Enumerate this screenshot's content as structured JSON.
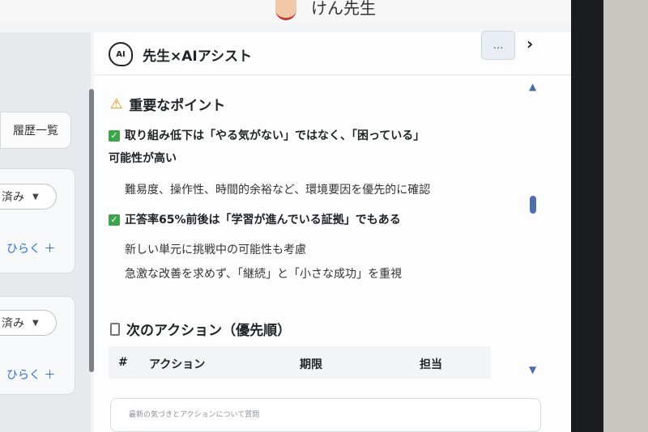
{
  "header": {
    "teacher_name": "けん先生"
  },
  "left": {
    "history_button": "履歴一覧",
    "cards": [
      {
        "status": "済み",
        "open": "ひらく ＋"
      },
      {
        "status": "済み",
        "open": "ひらく ＋"
      }
    ]
  },
  "panel": {
    "title": "先生×AIアシスト",
    "ai_icon_text": "AI",
    "more_label": "…",
    "important": {
      "heading": "重要なポイント",
      "points": [
        {
          "title_line1": "取り組み低下は「やる気がない」ではなく、「困っている」",
          "title_line2": "可能性が高い",
          "subs": [
            "難易度、操作性、時間的余裕など、環境要因を優先的に確認"
          ]
        },
        {
          "title_line1": "正答率65%前後は「学習が進んでいる証拠」でもある",
          "subs": [
            "新しい単元に挑戦中の可能性も考慮",
            "急激な改善を求めず、「継続」と「小さな成功」を重視"
          ]
        }
      ]
    },
    "actions": {
      "heading": "次のアクション（優先順）",
      "columns": [
        "#",
        "アクション",
        "期限",
        "担当"
      ]
    },
    "input_placeholder": "最新の気づきとアクションについて質問"
  },
  "colors": {
    "accent": "#2f6fd1",
    "check": "#3fa34d",
    "warn": "#e08a00"
  },
  "icons": [
    "ai-icon",
    "warning-icon",
    "check-icon",
    "clipboard-icon",
    "chevron-right-icon",
    "chevron-down-icon",
    "mouse-cursor-icon"
  ]
}
